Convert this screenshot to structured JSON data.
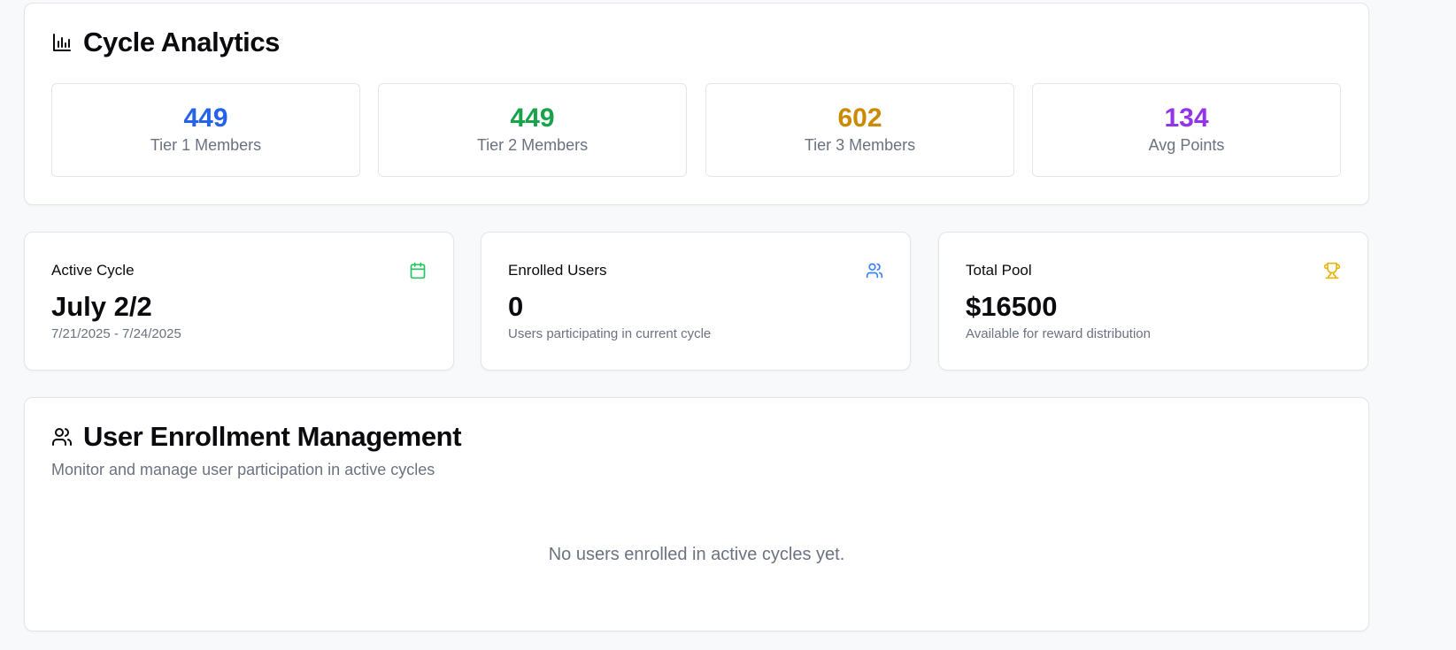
{
  "analytics": {
    "title": "Cycle Analytics",
    "icon": "bar-chart-icon",
    "stats": [
      {
        "value": "449",
        "label": "Tier 1 Members",
        "color": "#2563eb"
      },
      {
        "value": "449",
        "label": "Tier 2 Members",
        "color": "#16a34a"
      },
      {
        "value": "602",
        "label": "Tier 3 Members",
        "color": "#ca8a04"
      },
      {
        "value": "134",
        "label": "Avg Points",
        "color": "#9333ea"
      }
    ]
  },
  "summary": {
    "active_cycle": {
      "label": "Active Cycle",
      "value": "July 2/2",
      "sub": "7/21/2025 - 7/24/2025",
      "icon": "calendar-icon",
      "icon_color": "#22c55e"
    },
    "enrolled_users": {
      "label": "Enrolled Users",
      "value": "0",
      "sub": "Users participating in current cycle",
      "icon": "users-icon",
      "icon_color": "#3b82f6"
    },
    "total_pool": {
      "label": "Total Pool",
      "value": "$16500",
      "sub": "Available for reward distribution",
      "icon": "trophy-icon",
      "icon_color": "#eab308"
    }
  },
  "enrollment": {
    "title": "User Enrollment Management",
    "icon": "users-icon",
    "description": "Monitor and manage user participation in active cycles",
    "empty_message": "No users enrolled in active cycles yet."
  }
}
